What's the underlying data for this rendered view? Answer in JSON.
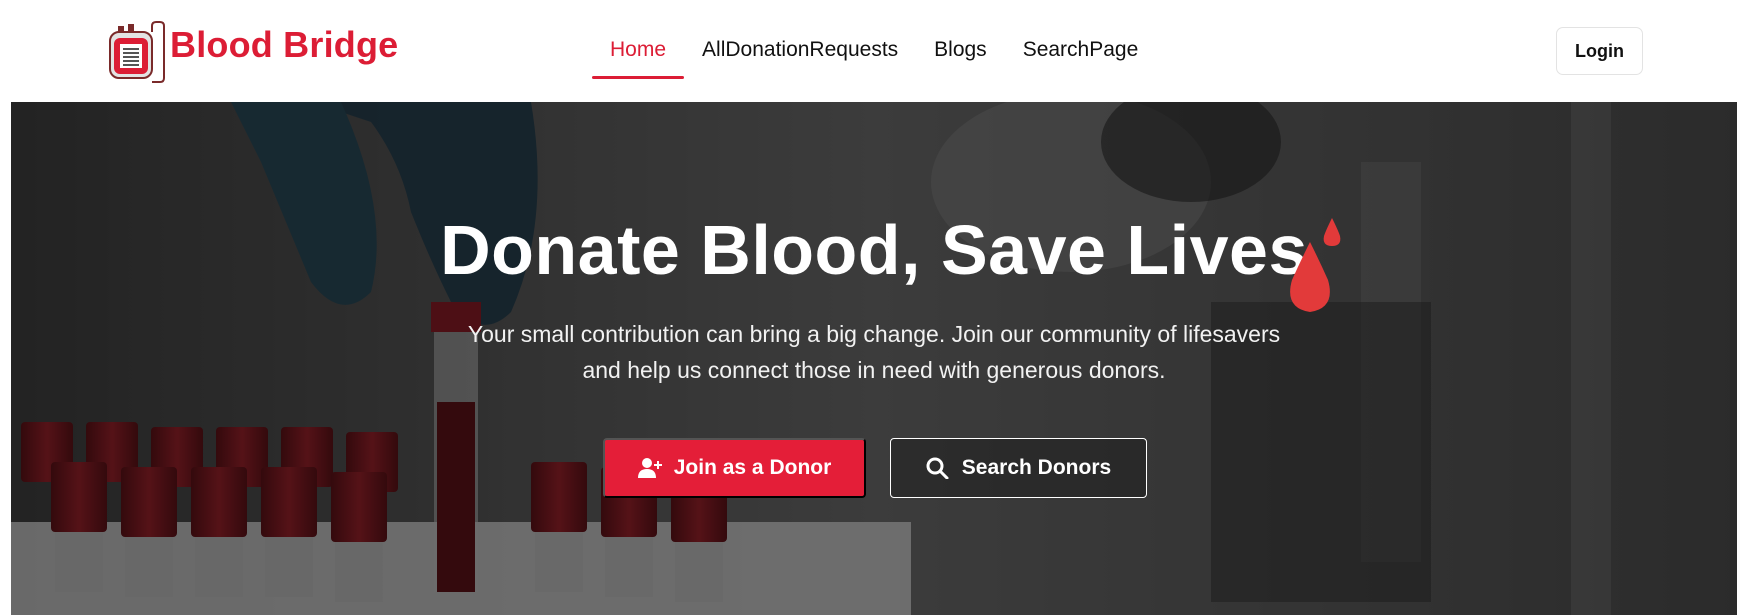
{
  "brand": {
    "name": "Blood Bridge",
    "logo_icon": "blood-bag-icon",
    "color": "#dc1d35"
  },
  "nav": {
    "items": [
      {
        "label": "Home",
        "active": true
      },
      {
        "label": "AllDonationRequests",
        "active": false
      },
      {
        "label": "Blogs",
        "active": false
      },
      {
        "label": "SearchPage",
        "active": false
      }
    ],
    "login_label": "Login"
  },
  "hero": {
    "title": "Donate Blood, Save Lives",
    "title_icon": "blood-drop-icon",
    "subtitle_line1": "Your small contribution can bring a big change. Join our community of lifesavers",
    "subtitle_line2": "and help us connect those in need with generous donors.",
    "primary_button": {
      "label": "Join as a Donor",
      "icon": "user-plus-icon",
      "color": "#e41e38"
    },
    "secondary_button": {
      "label": "Search Donors",
      "icon": "search-icon"
    }
  }
}
